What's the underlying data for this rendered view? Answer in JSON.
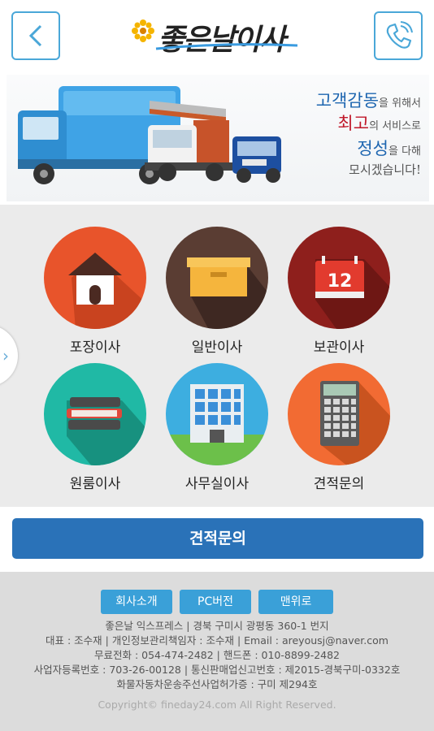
{
  "header": {
    "logo_text": "좋은날이사",
    "back_icon": "chevron-left-icon",
    "call_icon": "phone-icon",
    "accent_color": "#4aa7d8"
  },
  "banner": {
    "slogan": [
      {
        "big": "고객감동",
        "rest": "을 위해서"
      },
      {
        "big": "최고",
        "rest": "의 서비스로"
      },
      {
        "big": "정성",
        "rest": "을 다해"
      },
      {
        "big": "",
        "rest": "모시겠습니다!"
      }
    ]
  },
  "menu": {
    "items": [
      {
        "label": "포장이사",
        "icon": "house-icon",
        "color": "#e8542b"
      },
      {
        "label": "일반이사",
        "icon": "box-icon",
        "color": "#5a3d33"
      },
      {
        "label": "보관이사",
        "icon": "calendar-icon",
        "color": "#8e1f1c",
        "calendar_day": "12"
      },
      {
        "label": "원룸이사",
        "icon": "books-icon",
        "color": "#20b9a5"
      },
      {
        "label": "사무실이사",
        "icon": "building-icon",
        "color": "#3daee0"
      },
      {
        "label": "견적문의",
        "icon": "calculator-icon",
        "color": "#f26b33"
      }
    ],
    "side_arrow_icon": "chevron-right-icon"
  },
  "cta": {
    "label": "견적문의",
    "color": "#2a72b8"
  },
  "footer": {
    "buttons": [
      "회사소개",
      "PC버전",
      "맨위로"
    ],
    "info_lines": [
      "좋은날 익스프레스 | 경북 구미시 광평동 360-1 번지",
      "대표 : 조수재 | 개인정보관리책임자 : 조수재 | Email : areyousj@naver.com",
      "무료전화 : 054-474-2482 | 핸드폰 : 010-8899-2482",
      "사업자등록번호 : 703-26-00128 | 통신판매업신고번호 : 제2015-경북구미-0332호",
      "화물자동차운송주선사업허가증 : 구미 제294호"
    ],
    "copyright": "Copyright© fineday24.com All Right Reserved."
  }
}
